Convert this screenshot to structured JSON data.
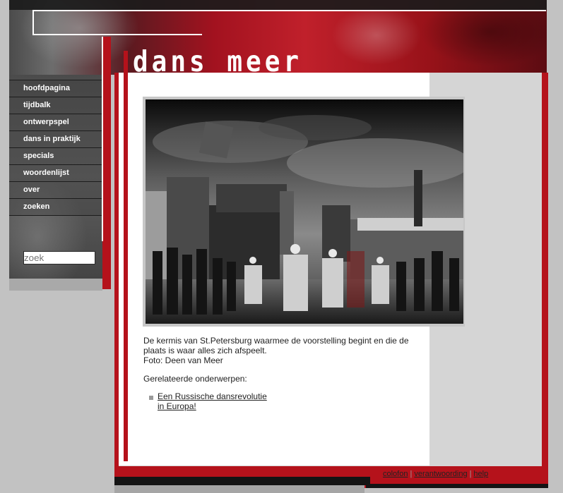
{
  "header": {
    "logo_text": "dans meer"
  },
  "sidebar": {
    "items": [
      {
        "label": "hoofdpagina"
      },
      {
        "label": "tijdbalk"
      },
      {
        "label": "ontwerpspel"
      },
      {
        "label": "dans in praktijk"
      },
      {
        "label": "specials"
      },
      {
        "label": "woordenlijst"
      },
      {
        "label": "over"
      },
      {
        "label": "zoeken"
      }
    ],
    "search_watermark": "zoek"
  },
  "main": {
    "caption_line1": "De kermis van St.Petersburg waarmee de voorstelling begint en die de plaats is waar alles zich afspeelt.",
    "caption_credit": "Foto: Deen van Meer",
    "related_heading": "Gerelateerde onderwerpen:",
    "related_links": [
      {
        "line1": "Een Russische dansrevolutie",
        "line2": "in Europa!"
      }
    ]
  },
  "footer": {
    "links": [
      {
        "label": "colofon"
      },
      {
        "label": "verantwoording"
      },
      {
        "label": "help"
      }
    ]
  },
  "colors": {
    "accent_red": "#b5121b",
    "content_bg": "#ffffff",
    "page_bg": "#c2c2c2"
  }
}
